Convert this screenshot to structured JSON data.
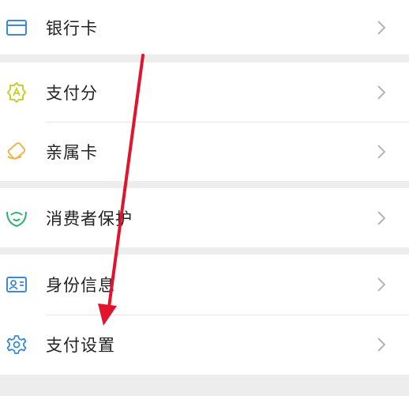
{
  "menu": {
    "bank_card": {
      "label": "银行卡",
      "icon": "bank-card-icon",
      "color": "#3a8ad6"
    },
    "pay_score": {
      "label": "支付分",
      "icon": "pay-score-icon",
      "color": "#c8cf2f"
    },
    "family_card": {
      "label": "亲属卡",
      "icon": "family-card-icon",
      "color": "#f0b44a"
    },
    "consumer_protection": {
      "label": "消费者保护",
      "icon": "consumer-protection-icon",
      "color": "#2fb36a"
    },
    "identity_info": {
      "label": "身份信息",
      "icon": "identity-info-icon",
      "color": "#3a8ad6"
    },
    "payment_settings": {
      "label": "支付设置",
      "icon": "gear-icon",
      "color": "#3a8ad6"
    }
  },
  "annotation": {
    "arrow_color": "#e0142e",
    "points_to": "payment_settings"
  }
}
